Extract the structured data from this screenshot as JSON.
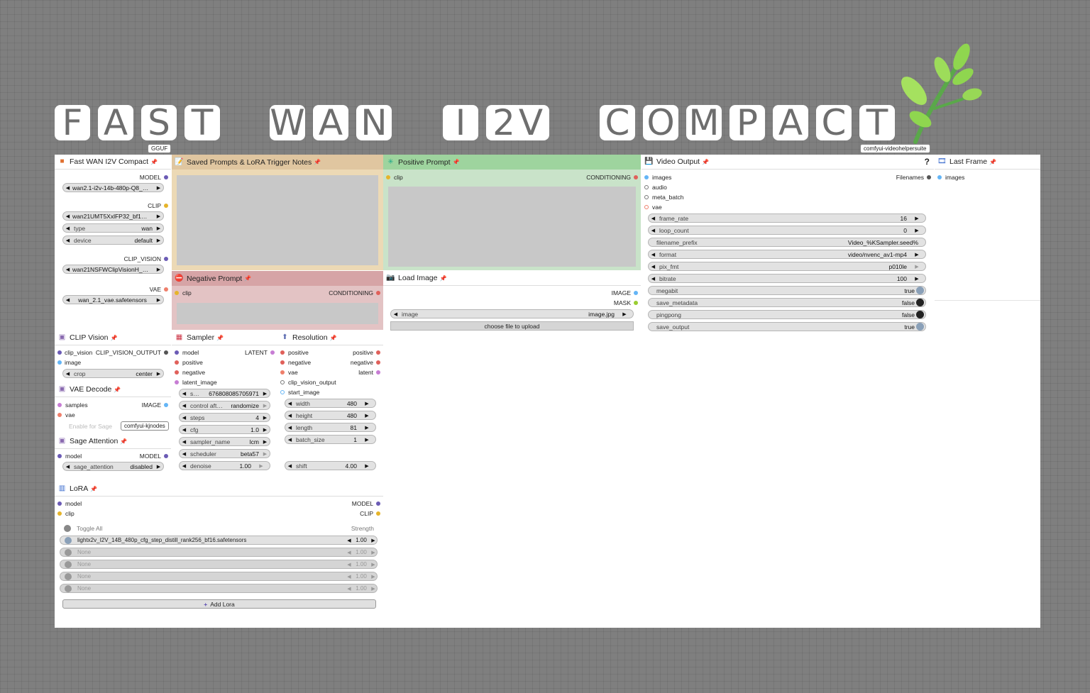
{
  "title": {
    "letters": [
      "F",
      "A",
      "S",
      "T",
      "W",
      "A",
      "N",
      "I",
      "2",
      "V",
      "C",
      "O",
      "M",
      "P",
      "A",
      "C",
      "T"
    ]
  },
  "tags": {
    "gguf": "GGUF",
    "vhs": "comfyui-videohelpersuite",
    "kj": "comfyui-kjnodes"
  },
  "colors": {
    "background": "#7f7f7f",
    "canvas": "#ffffff",
    "notes": "#ecd9b5",
    "positive": "#c9e3c9",
    "negative": "#e3c3c4",
    "wire_model": "#6b5bb5",
    "wire_clip": "#e6b42a",
    "wire_vae": "#ef7f6b",
    "wire_image": "#64b5f6",
    "wire_latent": "#c77dd4",
    "wire_cond": "#e0605a"
  },
  "loader": {
    "title": "Fast WAN I2V Compact",
    "model_label": "MODEL",
    "model_value": "wan2.1-i2v-14b-480p-Q8_…",
    "clip_label": "CLIP",
    "clip_value": "wan21UMT5XxlFP32_bf1…",
    "type_label": "type",
    "type_value": "wan",
    "device_label": "device",
    "device_value": "default",
    "cv_label": "CLIP_VISION",
    "cv_value": "wan21NSFWClipVisionH_…",
    "vae_label": "VAE",
    "vae_value": "wan_2.1_vae.safetensors"
  },
  "notes": {
    "title": "Saved Prompts & LoRA Trigger Notes"
  },
  "positive": {
    "title": "Positive Prompt",
    "in": "clip",
    "out": "CONDITIONING"
  },
  "negative": {
    "title": "Negative Prompt",
    "in": "clip",
    "out": "CONDITIONING"
  },
  "load_image": {
    "title": "Load Image",
    "out_image": "IMAGE",
    "out_mask": "MASK",
    "image_label": "image",
    "image_value": "image.jpg",
    "upload": "choose file to upload"
  },
  "video": {
    "title": "Video Output",
    "help": "?",
    "inputs": [
      "images",
      "audio",
      "meta_batch",
      "vae"
    ],
    "out": "Filenames",
    "frame_rate": {
      "label": "frame_rate",
      "value": "16"
    },
    "loop_count": {
      "label": "loop_count",
      "value": "0"
    },
    "filename_prefix": {
      "label": "filename_prefix",
      "value": "Video_%KSampler.seed%"
    },
    "format": {
      "label": "format",
      "value": "video/nvenc_av1-mp4"
    },
    "pix_fmt": {
      "label": "pix_fmt",
      "value": "p010le"
    },
    "bitrate": {
      "label": "bitrate",
      "value": "100"
    },
    "megabit": {
      "label": "megabit",
      "value": "true"
    },
    "save_metadata": {
      "label": "save_metadata",
      "value": "false"
    },
    "pingpong": {
      "label": "pingpong",
      "value": "false"
    },
    "save_output": {
      "label": "save_output",
      "value": "true"
    }
  },
  "last_frame": {
    "title": "Last Frame",
    "in": "images"
  },
  "clip_vision": {
    "title": "CLIP Vision",
    "in1": "clip_vision",
    "out": "CLIP_VISION_OUTPUT",
    "in2": "image",
    "crop_label": "crop",
    "crop_value": "center"
  },
  "vae_decode": {
    "title": "VAE Decode",
    "in1": "samples",
    "out": "IMAGE",
    "in2": "vae",
    "hidden": "Enable for Sage"
  },
  "sage": {
    "title": "Sage Attention",
    "in": "model",
    "out": "MODEL",
    "label": "sage_attention",
    "value": "disabled"
  },
  "sampler": {
    "title": "Sampler",
    "inputs": [
      "model",
      "positive",
      "negative",
      "latent_image"
    ],
    "out": "LATENT",
    "seed": {
      "label": "s…",
      "value": "676808085705971"
    },
    "control": {
      "label": "control aft…",
      "value": "randomize"
    },
    "steps": {
      "label": "steps",
      "value": "4"
    },
    "cfg": {
      "label": "cfg",
      "value": "1.0"
    },
    "sampler_name": {
      "label": "sampler_name",
      "value": "lcm"
    },
    "scheduler": {
      "label": "scheduler",
      "value": "beta57"
    },
    "denoise": {
      "label": "denoise",
      "value": "1.00"
    }
  },
  "resolution": {
    "title": "Resolution",
    "inputs": [
      "positive",
      "negative",
      "vae",
      "clip_vision_output",
      "start_image"
    ],
    "outputs": [
      "positive",
      "negative",
      "latent"
    ],
    "width": {
      "label": "width",
      "value": "480"
    },
    "height": {
      "label": "height",
      "value": "480"
    },
    "length": {
      "label": "length",
      "value": "81"
    },
    "batch_size": {
      "label": "batch_size",
      "value": "1"
    },
    "shift": {
      "label": "shift",
      "value": "4.00"
    }
  },
  "lora": {
    "title": "LoRA",
    "in_model": "model",
    "in_clip": "clip",
    "out_model": "MODEL",
    "out_clip": "CLIP",
    "toggle_all": "Toggle All",
    "strength": "Strength",
    "rows": [
      {
        "name": "lightx2v_I2V_14B_480p_cfg_step_distill_rank256_bf16.safetensors",
        "value": "1.00"
      },
      {
        "name": "None",
        "value": "1.00"
      },
      {
        "name": "None",
        "value": "1.00"
      },
      {
        "name": "None",
        "value": "1.00"
      },
      {
        "name": "None",
        "value": "1.00"
      }
    ],
    "add": "Add Lora"
  }
}
